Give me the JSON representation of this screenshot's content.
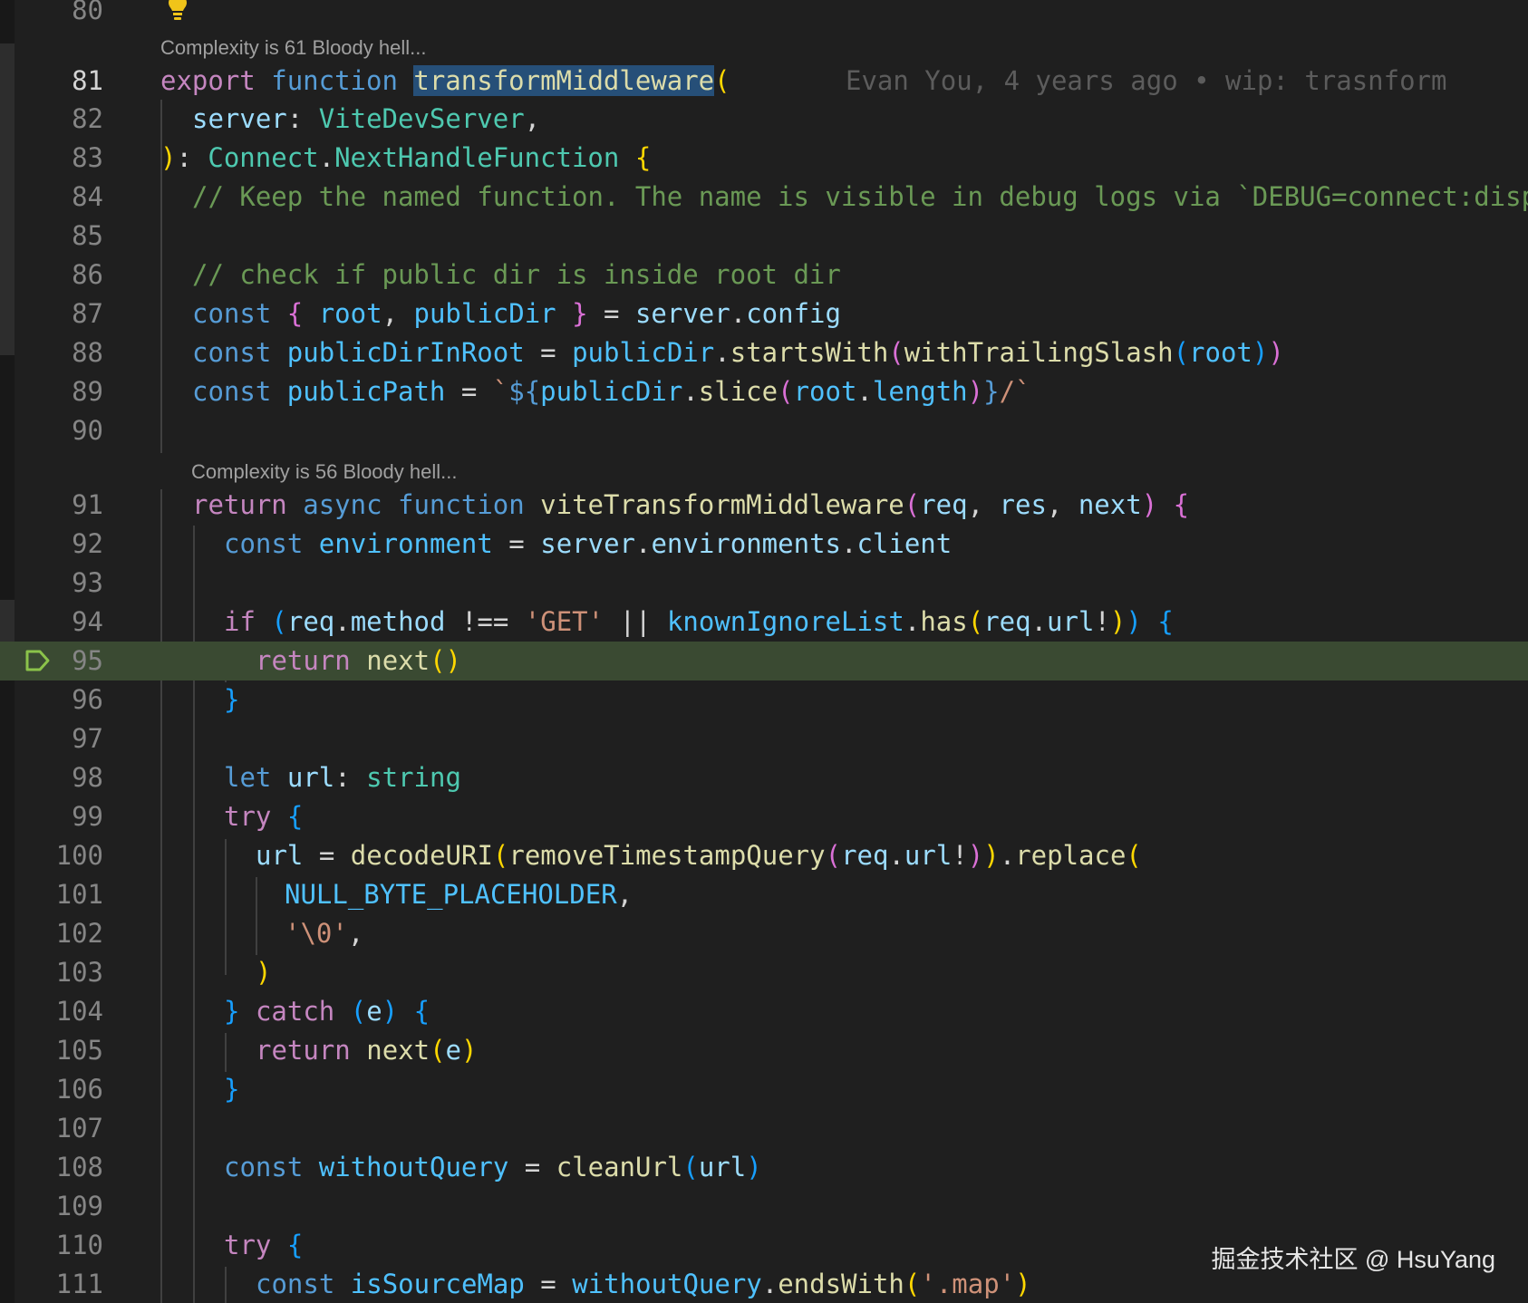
{
  "editor": {
    "codelens": {
      "transform": "Complexity is 61 Bloody hell...",
      "vite": "Complexity is 56 Bloody hell..."
    },
    "blame": "Evan You, 4 years ago • wip: trasnform",
    "watermark": "掘金技术社区 @ HsuYang",
    "current_line": 95,
    "active_line": 81,
    "lines": {
      "80": {
        "number": "80"
      },
      "81": {
        "number": "81",
        "tokens": {
          "a": "export",
          "b": " ",
          "c": "function",
          "d": " ",
          "e": "transformMiddleware",
          "f": "("
        }
      },
      "82": {
        "number": "82",
        "tokens": {
          "a": "server",
          "b": ": ",
          "c": "ViteDevServer",
          "d": ","
        }
      },
      "83": {
        "number": "83",
        "tokens": {
          "a": ")",
          "b": ": ",
          "c": "Connect",
          "d": ".",
          "e": "NextHandleFunction",
          "f": " ",
          "g": "{"
        }
      },
      "84": {
        "number": "84",
        "tokens": {
          "a": "// Keep the named function. The name is visible in debug logs via `DEBUG=connect:dispatcher ...`"
        }
      },
      "85": {
        "number": "85"
      },
      "86": {
        "number": "86",
        "tokens": {
          "a": "// check if public dir is inside root dir"
        }
      },
      "87": {
        "number": "87",
        "tokens": {
          "a": "const",
          "b": " ",
          "c": "{",
          "d": " ",
          "e": "root",
          "f": ", ",
          "g": "publicDir",
          "h": " ",
          "i": "}",
          "j": " = ",
          "k": "server",
          "l": ".",
          "m": "config"
        }
      },
      "88": {
        "number": "88",
        "tokens": {
          "a": "const",
          "b": " ",
          "c": "publicDirInRoot",
          "d": " = ",
          "e": "publicDir",
          "f": ".",
          "g": "startsWith",
          "h": "(",
          "i": "withTrailingSlash",
          "j": "(",
          "k": "root",
          "l": ")",
          "m": ")"
        }
      },
      "89": {
        "number": "89",
        "tokens": {
          "a": "const",
          "b": " ",
          "c": "publicPath",
          "d": " = ",
          "e": "`",
          "f": "${",
          "g": "publicDir",
          "h": ".",
          "i": "slice",
          "j": "(",
          "k": "root",
          "l": ".",
          "m": "length",
          "n": ")",
          "o": "}",
          "p": "/`"
        }
      },
      "90": {
        "number": "90"
      },
      "91": {
        "number": "91",
        "tokens": {
          "a": "return",
          "b": " ",
          "c": "async",
          "d": " ",
          "e": "function",
          "f": " ",
          "g": "viteTransformMiddleware",
          "h": "(",
          "i": "req",
          "j": ", ",
          "k": "res",
          "l": ", ",
          "m": "next",
          "n": ")",
          "o": " ",
          "p": "{"
        }
      },
      "92": {
        "number": "92",
        "tokens": {
          "a": "const",
          "b": " ",
          "c": "environment",
          "d": " = ",
          "e": "server",
          "f": ".",
          "g": "environments",
          "h": ".",
          "i": "client"
        }
      },
      "93": {
        "number": "93"
      },
      "94": {
        "number": "94",
        "tokens": {
          "a": "if",
          "b": " ",
          "c": "(",
          "d": "req",
          "e": ".",
          "f": "method",
          "g": " !== ",
          "h": "'GET'",
          "i": " || ",
          "j": "knownIgnoreList",
          "k": ".",
          "l": "has",
          "m": "(",
          "n": "req",
          "o": ".",
          "p": "url",
          "q": "!",
          "r": ")",
          "s": ")",
          "t": " ",
          "u": "{"
        }
      },
      "95": {
        "number": "95",
        "tokens": {
          "a": "return",
          "b": " ",
          "c": "next",
          "d": "()"
        }
      },
      "96": {
        "number": "96",
        "tokens": {
          "a": "}"
        }
      },
      "97": {
        "number": "97"
      },
      "98": {
        "number": "98",
        "tokens": {
          "a": "let",
          "b": " ",
          "c": "url",
          "d": ": ",
          "e": "string"
        }
      },
      "99": {
        "number": "99",
        "tokens": {
          "a": "try",
          "b": " ",
          "c": "{"
        }
      },
      "100": {
        "number": "100",
        "tokens": {
          "a": "url",
          "b": " = ",
          "c": "decodeURI",
          "d": "(",
          "e": "removeTimestampQuery",
          "f": "(",
          "g": "req",
          "h": ".",
          "i": "url",
          "j": "!",
          "k": ")",
          "l": ")",
          "m": ".",
          "n": "replace",
          "o": "("
        }
      },
      "101": {
        "number": "101",
        "tokens": {
          "a": "NULL_BYTE_PLACEHOLDER",
          "b": ","
        }
      },
      "102": {
        "number": "102",
        "tokens": {
          "a": "'\\0'",
          "b": ","
        }
      },
      "103": {
        "number": "103",
        "tokens": {
          "a": ")"
        }
      },
      "104": {
        "number": "104",
        "tokens": {
          "a": "}",
          "b": " ",
          "c": "catch",
          "d": " ",
          "e": "(",
          "f": "e",
          "g": ")",
          "h": " ",
          "i": "{"
        }
      },
      "105": {
        "number": "105",
        "tokens": {
          "a": "return",
          "b": " ",
          "c": "next",
          "d": "(",
          "e": "e",
          "f": ")"
        }
      },
      "106": {
        "number": "106",
        "tokens": {
          "a": "}"
        }
      },
      "107": {
        "number": "107"
      },
      "108": {
        "number": "108",
        "tokens": {
          "a": "const",
          "b": " ",
          "c": "withoutQuery",
          "d": " = ",
          "e": "cleanUrl",
          "f": "(",
          "g": "url",
          "h": ")"
        }
      },
      "109": {
        "number": "109"
      },
      "110": {
        "number": "110",
        "tokens": {
          "a": "try",
          "b": " ",
          "c": "{"
        }
      },
      "111": {
        "number": "111",
        "tokens": {
          "a": "const",
          "b": " ",
          "c": "isSourceMap",
          "d": " = ",
          "e": "withoutQuery",
          "f": ".",
          "g": "endsWith",
          "h": "(",
          "i": "'.map'",
          "j": ")"
        }
      }
    }
  },
  "icons": {
    "lightbulb": "lightbulb-icon",
    "breakpoint": "debug-stackframe-icon"
  },
  "colors": {
    "background": "#1f1f1f",
    "current_line_highlight": "#3a4a32",
    "keyword": "#c586c0",
    "storage": "#569cd6",
    "function": "#dcdcaa",
    "variable": "#9cdcfe",
    "type": "#4ec9b0",
    "string": "#ce9178",
    "comment": "#6a9955",
    "lightbulb": "#f0c419",
    "breakpoint": "#8bc34a"
  }
}
